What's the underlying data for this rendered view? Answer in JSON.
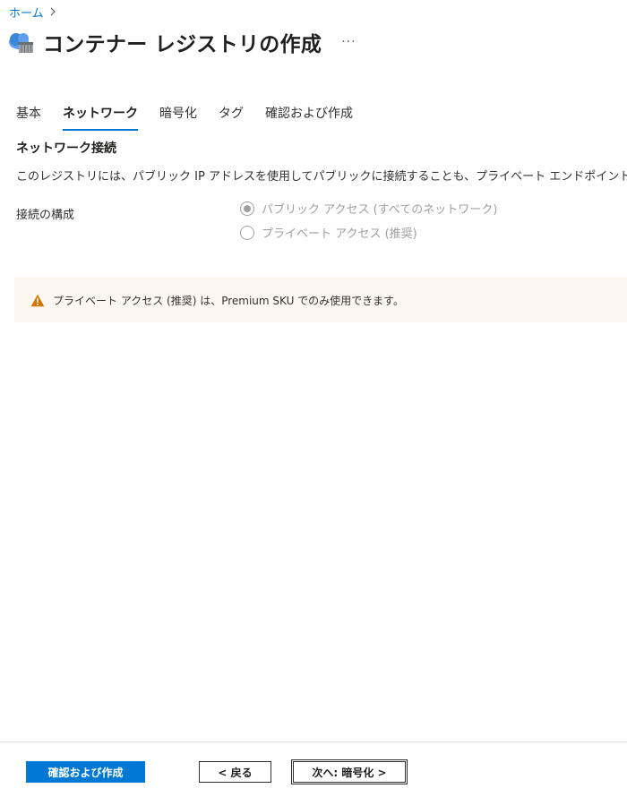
{
  "breadcrumb": {
    "home_label": "ホーム",
    "separator": ">"
  },
  "header": {
    "title": "コンテナー レジストリの作成",
    "more_label": "···",
    "icon": "container-registry-icon"
  },
  "tabs": [
    {
      "label": "基本",
      "active": false
    },
    {
      "label": "ネットワーク",
      "active": true
    },
    {
      "label": "暗号化",
      "active": false
    },
    {
      "label": "タグ",
      "active": false
    },
    {
      "label": "確認および作成",
      "active": false
    }
  ],
  "network": {
    "heading": "ネットワーク接続",
    "description": "このレジストリには、パブリック IP アドレスを使用してパブリックに接続することも、プライベート エンドポイントを使用してプライベートに接続することもできます。",
    "connectivity_label": "接続の構成",
    "options": [
      {
        "label": "パブリック アクセス (すべてのネットワーク)",
        "selected": true,
        "disabled": true
      },
      {
        "label": "プライベート アクセス (推奨)",
        "selected": false,
        "disabled": true
      }
    ]
  },
  "warning": {
    "icon": "warning-icon",
    "text": "プライベート アクセス (推奨) は、Premium SKU でのみ使用できます。"
  },
  "footer": {
    "review_create_label": "確認および作成",
    "back_label": "< 戻る",
    "next_label": "次へ: 暗号化 >"
  },
  "colors": {
    "accent": "#0078d4",
    "warning_bg": "#fdf7f1",
    "warning_icon": "#d47500",
    "disabled_text": "#a19f9d"
  }
}
